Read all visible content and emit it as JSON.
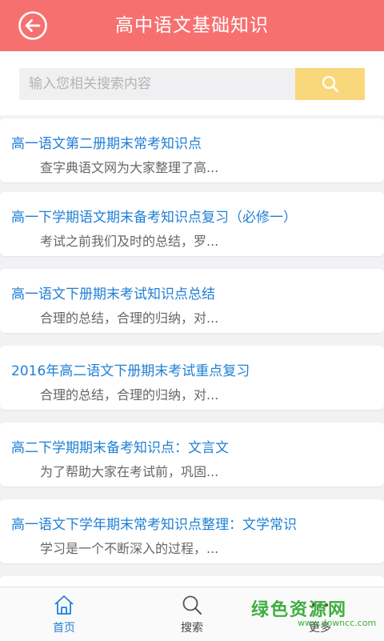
{
  "header": {
    "title": "高中语文基础知识",
    "back_icon": "back-arrow-icon"
  },
  "search": {
    "placeholder": "输入您相关搜索内容",
    "icon": "search-icon"
  },
  "articles": [
    {
      "title": "高一语文第二册期末常考知识点",
      "desc": "查字典语文网为大家整理了高..."
    },
    {
      "title": "高一下学期语文期末备考知识点复习（必修一）",
      "desc": "考试之前我们及时的总结，罗..."
    },
    {
      "title": "高一语文下册期末考试知识点总结",
      "desc": "合理的总结，合理的归纳，对..."
    },
    {
      "title": "2016年高二语文下册期末考试重点复习",
      "desc": "合理的总结，合理的归纳，对..."
    },
    {
      "title": "高二下学期期末备考知识点：文言文",
      "desc": "为了帮助大家在考试前，巩固..."
    },
    {
      "title": "高一语文下学年期末常考知识点整理：文学常识",
      "desc": "学习是一个不断深入的过程，..."
    }
  ],
  "tabs": [
    {
      "label": "首页",
      "icon": "home-icon",
      "active": true
    },
    {
      "label": "搜索",
      "icon": "search-icon",
      "active": false
    },
    {
      "label": "更多",
      "icon": "more-icon",
      "active": false
    }
  ],
  "watermark": {
    "text": "绿色资源网",
    "url": "www.downcc.com"
  },
  "colors": {
    "header": "#f77070",
    "search_button": "#f9d87c",
    "link": "#1f7fd6",
    "background": "#f2f2f4",
    "watermark": "#3fae3f"
  }
}
